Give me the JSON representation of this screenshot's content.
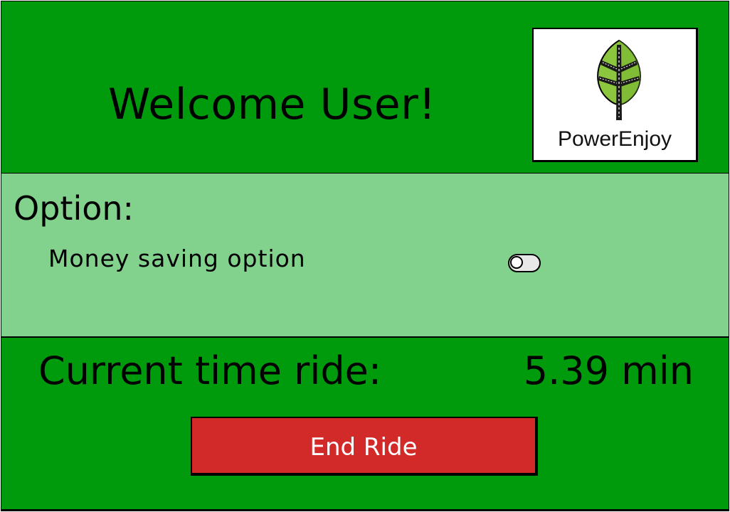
{
  "header": {
    "welcome_text": "Welcome User!",
    "logo_text": "PowerEnjoy",
    "logo_icon": "leaf-road-icon"
  },
  "options": {
    "title": "Option:",
    "items": [
      {
        "label": "Money saving option",
        "enabled": false
      }
    ]
  },
  "ride": {
    "time_label": "Current time ride:",
    "time_value": "5.39 min",
    "end_button_label": "End Ride"
  },
  "colors": {
    "header_bg": "#009a0d",
    "options_bg": "#82d18d",
    "end_button_bg": "#d22a28",
    "leaf_green": "#8cc63f"
  }
}
